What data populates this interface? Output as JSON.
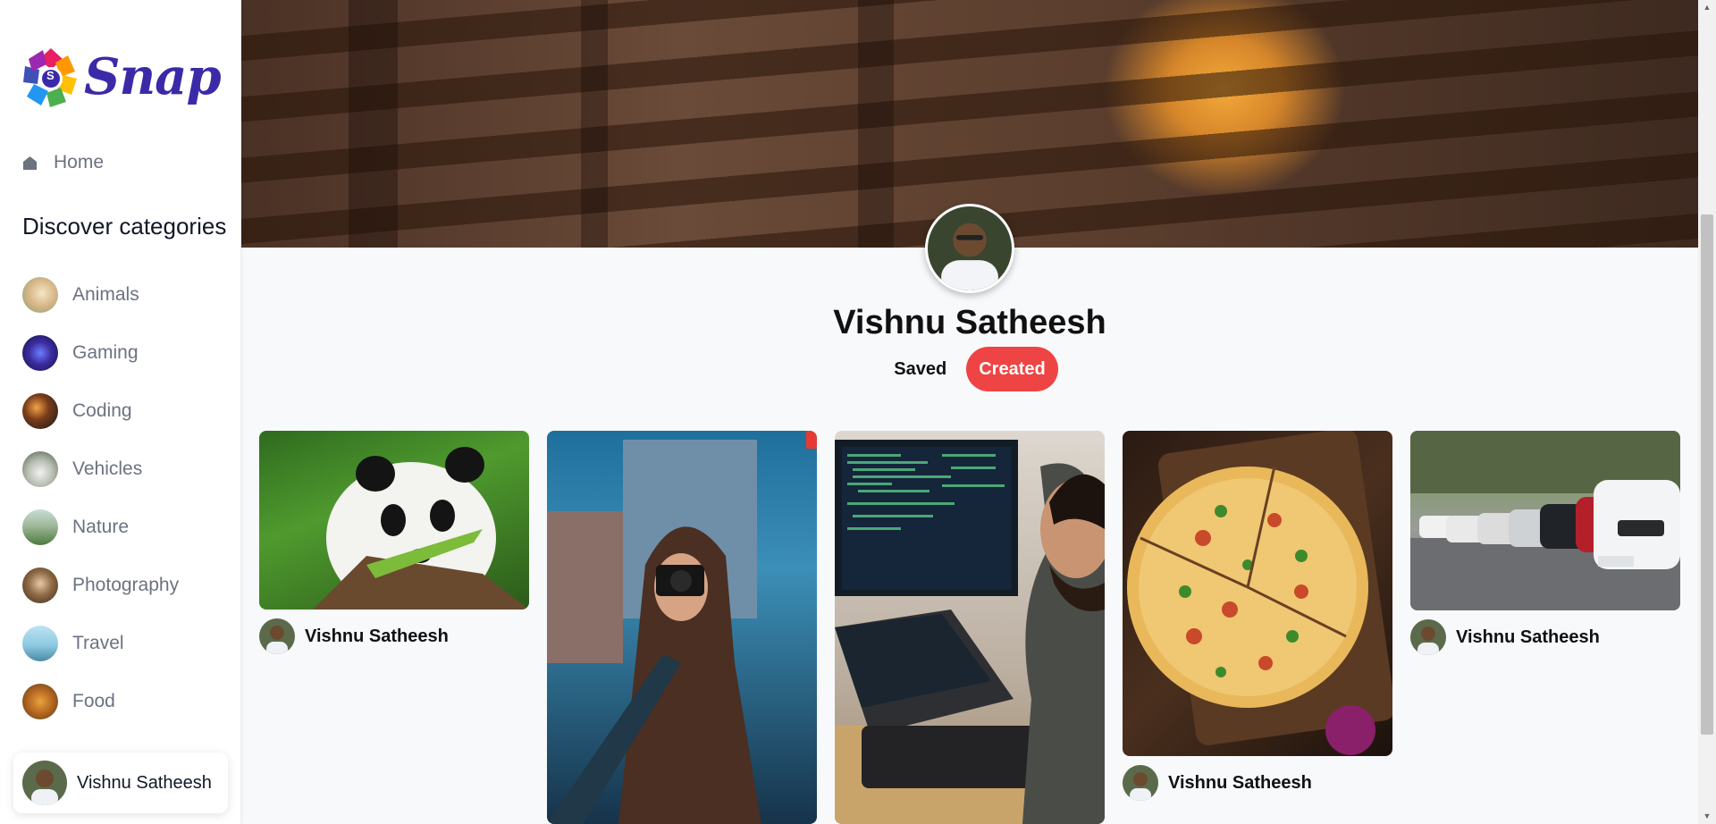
{
  "app": {
    "logo_text": "Snap",
    "logo_badge": "S"
  },
  "sidebar": {
    "home_label": "Home",
    "section_title": "Discover categories",
    "categories": [
      {
        "label": "Animals"
      },
      {
        "label": "Gaming"
      },
      {
        "label": "Coding"
      },
      {
        "label": "Vehicles"
      },
      {
        "label": "Nature"
      },
      {
        "label": "Photography"
      },
      {
        "label": "Travel"
      },
      {
        "label": "Food"
      }
    ],
    "user_name": "Vishnu Satheesh"
  },
  "profile": {
    "name": "Vishnu Satheesh",
    "tabs": [
      {
        "label": "Saved"
      },
      {
        "label": "Created"
      }
    ],
    "active_tab": "Created"
  },
  "pins": [
    {
      "subject": "panda eating bamboo",
      "author": "Vishnu Satheesh"
    },
    {
      "subject": "woman with camera in city",
      "author": ""
    },
    {
      "subject": "developer at computer",
      "author": ""
    },
    {
      "subject": "pizza on wooden board",
      "author": "Vishnu Satheesh"
    },
    {
      "subject": "row of parked cars",
      "author": "Vishnu Satheesh"
    }
  ],
  "colors": {
    "accent": "#ef4444",
    "brand": "#3b2aa8",
    "text_muted": "#6b7280"
  }
}
